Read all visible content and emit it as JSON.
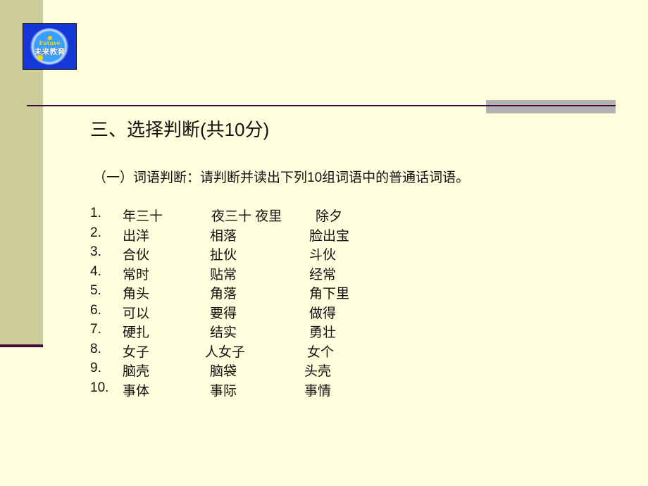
{
  "logo": {
    "en": "Future",
    "zh": "未来教育"
  },
  "title": "三、选择判断(共10分)",
  "subtitle": "（一）词语判断：请判断并读出下列10组词语中的普通话词语。",
  "items": [
    {
      "num": "1.",
      "a": "年三十",
      "b": "夜三十 夜里",
      "c": "除夕"
    },
    {
      "num": "2.",
      "a": "出洋",
      "b": "相落",
      "c": "脸出宝"
    },
    {
      "num": "3.",
      "a": "合伙",
      "b": "扯伙",
      "c": "斗伙"
    },
    {
      "num": "4.",
      "a": "常时",
      "b": "贴常",
      "c": "经常"
    },
    {
      "num": "5.",
      "a": "角头",
      "b": "角落",
      "c": "角下里"
    },
    {
      "num": "6.",
      "a": "可以",
      "b": "要得",
      "c": "做得"
    },
    {
      "num": "7.",
      "a": "硬扎",
      "b": "结实",
      "c": "勇壮"
    },
    {
      "num": "8.",
      "a": "女子",
      "b": "人女子",
      "c": "女个"
    },
    {
      "num": "9.",
      "a": "脑壳",
      "b": "脑袋",
      "c": "头壳"
    },
    {
      "num": "10.",
      "a": "事体",
      "b": "事际",
      "c": "事情"
    }
  ]
}
